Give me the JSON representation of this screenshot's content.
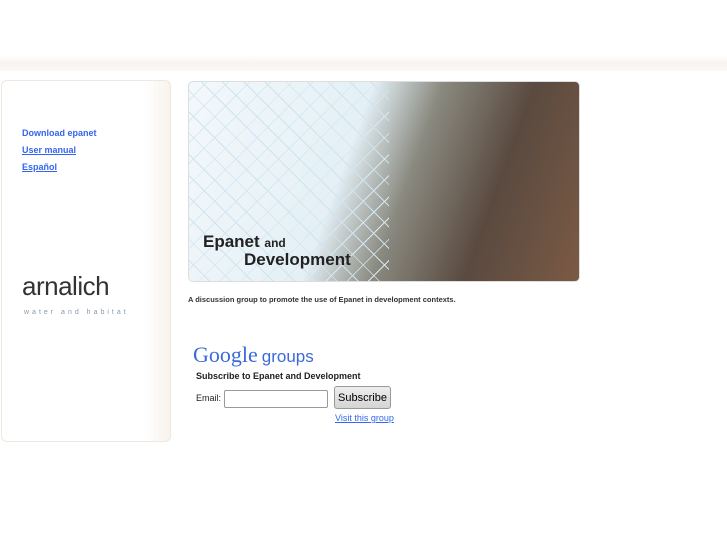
{
  "sidebar": {
    "links": [
      {
        "label": "Download epanet"
      },
      {
        "label": "User manual"
      },
      {
        "label": "Español"
      }
    ],
    "logo": "arnalich",
    "tagline": "water and habitat"
  },
  "hero": {
    "title_word": "Epanet",
    "title_and": "and",
    "title_line2": "Development"
  },
  "description": "A discussion group to promote the use of Epanet in development contexts.",
  "google_groups": {
    "logo_google": "Google",
    "logo_groups": "groups",
    "subscribe_heading": "Subscribe to Epanet and Development",
    "email_label": "Email:",
    "email_value": "",
    "subscribe_button": "Subscribe",
    "visit_link": "Visit this group"
  }
}
